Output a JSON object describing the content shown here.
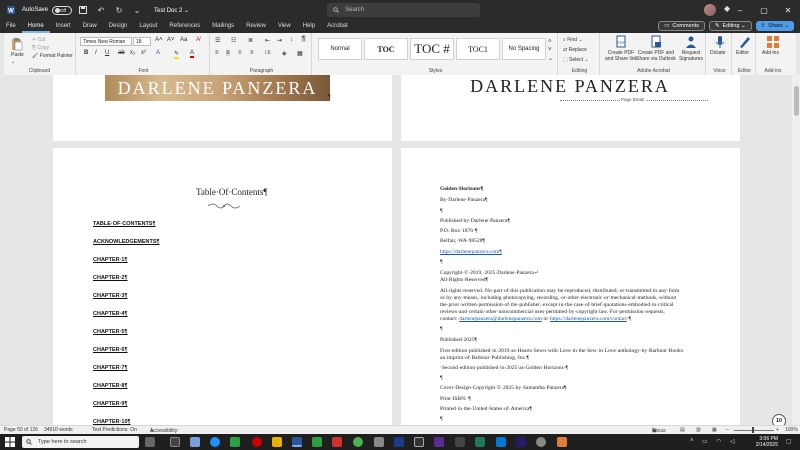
{
  "titlebar": {
    "autosave_label": "AutoSave",
    "autosave_state": "Off",
    "doc_title": "Test Doc 2 ⌄",
    "search_placeholder": "Search",
    "window_controls": [
      "–",
      "▢",
      "✕"
    ]
  },
  "menu": {
    "tabs": [
      "File",
      "Home",
      "Insert",
      "Draw",
      "Design",
      "Layout",
      "References",
      "Mailings",
      "Review",
      "View",
      "Help",
      "Acrobat"
    ],
    "active_tab": "Home",
    "comments_label": "Comments",
    "editing_label": "Editing ⌄",
    "share_label": "Share ⌄"
  },
  "ribbon": {
    "clipboard": {
      "paste": "Paste",
      "cut": "Cut",
      "copy": "Copy",
      "format_painter": "Format Painter",
      "group": "Clipboard"
    },
    "font": {
      "family": "Times New Roman",
      "size": "18",
      "group": "Font"
    },
    "paragraph": {
      "group": "Paragraph"
    },
    "styles": {
      "items": [
        "Normal",
        "TOC",
        "TOC #",
        "TOC1",
        "No Spacing"
      ],
      "group": "Styles"
    },
    "editing": {
      "find": "Find ⌄",
      "replace": "Replace",
      "select": "Select ⌄",
      "group": "Editing"
    },
    "acrobat": {
      "create_pdf_share": "Create PDF and Share link",
      "create_pdf_outlook": "Create PDF and Share via Outlook",
      "request_signatures": "Request Signatures",
      "group": "Adobe Acrobat"
    },
    "voice": {
      "dictate": "Dictate",
      "group": "Voice"
    },
    "editor": {
      "label": "Editor",
      "group": "Editor"
    },
    "addins": {
      "label": "Add-ins",
      "group": "Add-ins"
    }
  },
  "document": {
    "banner_text": "DARLENE PANZERA",
    "right_title": "DARLENE PANZERA",
    "page_break": "Page Break",
    "toc_title": "Table·Of·Contents¶",
    "toc_entries": [
      "TABLE·OF·CONTENTS¶",
      "ACKNOWLEDGEMENTS¶",
      "CHAPTER·1¶",
      "CHAPTER·2¶",
      "CHAPTER·3¶",
      "CHAPTER·4¶",
      "CHAPTER·5¶",
      "CHAPTER·6¶",
      "CHAPTER·7¶",
      "CHAPTER·8¶",
      "CHAPTER·9¶",
      "CHAPTER·10¶"
    ],
    "copyright_page": {
      "book_title": "Golden·Horizons¶",
      "by": "By·Darlene·Panzera¶",
      "blank": "¶",
      "published_by": "Published·by·Darlene·Panzera¶",
      "po_box": "P.O.·Box·1876·¶",
      "city": "Belfair,·WA·98528¶",
      "website": "https://darlenepanzera.com¶",
      "copyright": "Copyright·©·2019,·2025·Darlene·Panzera↵",
      "rights": "All·Rights·Reserved¶",
      "legal_1": "All·rights·reserved.·No·part·of·this·publication·may·be·reproduced,·distributed,·or·transmitted·in·any·form",
      "legal_2": "or·by·any·means,·including·photocopying,·recording,·or·other·electronic·or·mechanical·methods,·without",
      "legal_3": "the·prior·written·permission·of·the·publisher,·except·in·the·case·of·brief·quotations·embodied·in·critical",
      "legal_4": "reviews·and·certain·other·noncommercial·uses·permitted·by·copyright·law.·For·permission·requests,",
      "legal_5_prefix": "contact:·",
      "legal_5_email": "darlenepanzera@darlenepanzera.com",
      "legal_5_mid": "·or·",
      "legal_5_url": "https://darlenepanzera.com/contact",
      "legal_5_suffix": "·¶",
      "published_year": "Published·2025¶",
      "first_edition_1": "First·edition·published·in·2019·as·Hearts·Sewn·with·Love·in·the·Sew·in·Love·anthology·by·Barbour·Books·",
      "first_edition_2": "an·imprint·of·Barbour·Publishing,·Inc.¶",
      "second_edition": "·Second·edition·published·in·2025·as·Golden·Horizons·¶",
      "cover_design": "Cover·Design·Copyright·©·2025·by·Samantha·Panzera¶",
      "print_isbn": "Print·ISBN:·¶",
      "printed_in": "Printed·in·the·United·States·of·America¶"
    }
  },
  "statusbar": {
    "page": "Page 50 of 126",
    "words": "34910 words",
    "text_predictions": "Text Predictions: On",
    "accessibility": "Accessibility: Investigate",
    "focus": "Focus",
    "zoom": "100%"
  },
  "taskbar": {
    "search_placeholder": "Type here to search",
    "time": "3:06 PM",
    "date": "2/14/2025",
    "notification_badge": "10"
  },
  "colors": {
    "titlebar": "#2b2b2b",
    "share": "#4e9be8",
    "link": "#1a55b4",
    "word_blue": "#2b579a"
  }
}
